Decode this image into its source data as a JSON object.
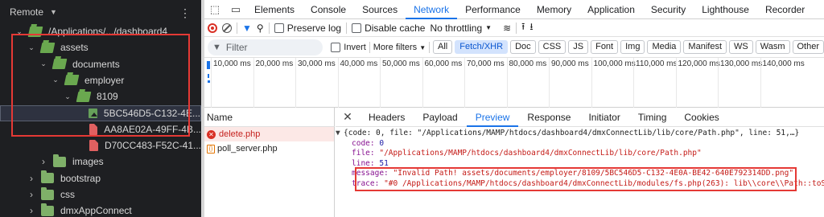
{
  "explorer": {
    "header": "Remote",
    "tree": [
      {
        "label": "/Applications/.../dashboard4",
        "kind": "folder-open",
        "depth": 0,
        "expanded": true
      },
      {
        "label": "assets",
        "kind": "folder-open",
        "depth": 1,
        "expanded": true
      },
      {
        "label": "documents",
        "kind": "folder-open",
        "depth": 2,
        "expanded": true
      },
      {
        "label": "employer",
        "kind": "folder-open",
        "depth": 3,
        "expanded": true
      },
      {
        "label": "8109",
        "kind": "folder-open",
        "depth": 4,
        "expanded": true
      },
      {
        "label": "5BC546D5-C132-4E...",
        "kind": "image",
        "depth": 5,
        "selected": true
      },
      {
        "label": "AA8AE02A-49FF-4B...",
        "kind": "pdf",
        "depth": 5
      },
      {
        "label": "D70CC483-F52C-41...",
        "kind": "pdf",
        "depth": 5
      },
      {
        "label": "images",
        "kind": "folder",
        "depth": 2,
        "expanded": false
      },
      {
        "label": "bootstrap",
        "kind": "folder",
        "depth": 1,
        "expanded": false
      },
      {
        "label": "css",
        "kind": "folder",
        "depth": 1,
        "expanded": false
      },
      {
        "label": "dmxAppConnect",
        "kind": "folder",
        "depth": 1,
        "expanded": false
      }
    ]
  },
  "devtools": {
    "tabs": [
      "Elements",
      "Console",
      "Sources",
      "Network",
      "Performance",
      "Memory",
      "Application",
      "Security",
      "Lighthouse",
      "Recorder"
    ],
    "active_tab": "Network",
    "toolbar": {
      "preserve_log": "Preserve log",
      "disable_cache": "Disable cache",
      "throttling": "No throttling"
    },
    "filter": {
      "placeholder": "Filter",
      "invert": "Invert",
      "more_filters": "More filters",
      "types": [
        "All",
        "Fetch/XHR",
        "Doc",
        "CSS",
        "JS",
        "Font",
        "Img",
        "Media",
        "Manifest",
        "WS",
        "Wasm",
        "Other"
      ],
      "active_type": "Fetch/XHR"
    },
    "timeline_ticks": [
      "10,000 ms",
      "20,000 ms",
      "30,000 ms",
      "40,000 ms",
      "50,000 ms",
      "60,000 ms",
      "70,000 ms",
      "80,000 ms",
      "90,000 ms",
      "100,000 ms",
      "110,000 ms",
      "120,000 ms",
      "130,000 ms",
      "140,000 ms"
    ],
    "requests": {
      "header": "Name",
      "rows": [
        {
          "name": "delete.php",
          "status": "error"
        },
        {
          "name": "poll_server.php",
          "status": "ok"
        }
      ]
    },
    "detail_tabs": [
      "Headers",
      "Payload",
      "Preview",
      "Response",
      "Initiator",
      "Timing",
      "Cookies"
    ],
    "active_detail_tab": "Preview",
    "preview": {
      "summary": "{code: 0, file: \"/Applications/MAMP/htdocs/dashboard4/dmxConnectLib/lib/core/Path.php\", line: 51,…}",
      "code_key": "code:",
      "code_val": "0",
      "file_key": "file:",
      "file_val": "\"/Applications/MAMP/htdocs/dashboard4/dmxConnectLib/lib/core/Path.php\"",
      "line_key": "line:",
      "line_val": "51",
      "message_key": "message:",
      "message_val": "\"Invalid Path! assets/documents/employer/8109/5BC546D5-C132-4E0A-BE42-640E792314DD.png\"",
      "trace_key": "trace:",
      "trace_val": "\"#0 /Applications/MAMP/htdocs/dashboard4/dmxConnectLib/modules/fs.php(263): lib\\\\core\\\\Path::toSy"
    }
  },
  "colors": {
    "highlight_box": "#e53935",
    "accent": "#1a73e8",
    "explorer_bg": "#1e1f22"
  }
}
